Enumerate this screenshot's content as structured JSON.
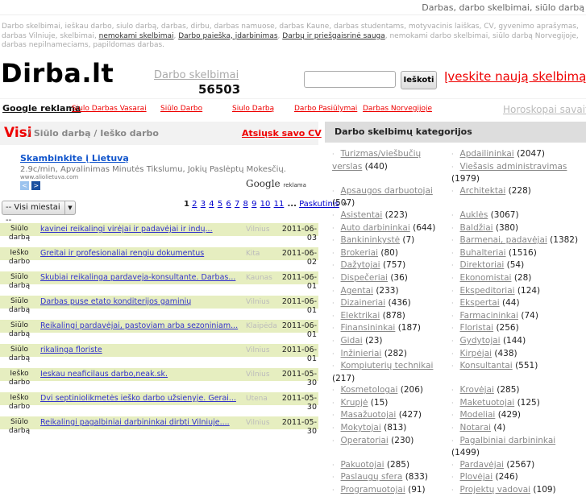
{
  "header": {
    "title": "Darbas, darbo skelbimai, siūlo darbą",
    "keywords_a": "Darbo skelbimai, ieškau darbo, siulo darbą, darbas, dirbu, darbas namuose, darbas Kaune, darbas studentams, motyvacinis laiškas, CV, gyvenimo aprašymas, darbas Vilniuje, skelbimai, ",
    "kw_link1": "nemokami skelbimai",
    "kw_link2": "Darbo paieška, įdarbinimas",
    "kw_link3": "Darbų ir priešgaisrinė sauga",
    "keywords_b": ", nemokami darbo skelbimai, siūlo darbą Norvegijoje, darbas nepilnameciams, papildomas darbas."
  },
  "logo": "Dirba.lt",
  "counter": {
    "label": "Darbo skelbimai",
    "value": "56503"
  },
  "search": {
    "value": "",
    "button": "Ieškoti"
  },
  "new_ad": "Įveskite naują skelbimą",
  "nav": {
    "google": "Google reklama",
    "links": [
      "Siulo Darbas Vasarai",
      "Siūlo Darbo",
      "Siulo Darbą",
      "Darbo Pasiūlymai",
      "Darbas Norvegijoje"
    ],
    "horoscope": "Horoskopai savaitei"
  },
  "tabs": {
    "all": "Visi",
    "sep": "/",
    "offers": "Siūlo darbą",
    "seeks": "Ieško darbo",
    "send_cv": "Atsiųsk savo CV"
  },
  "ad": {
    "title": "Skambinkite į Lietuvą",
    "desc": "2.9c/min, Apvalinimas Minutės Tikslumu, Jokių Paslėptų Mokesčių.",
    "url": "www.aliolietuva.com",
    "google": "Google",
    "reklama": "reklama"
  },
  "city_select": "-- Visi miestai --",
  "pager": {
    "current": "1",
    "pages": [
      "2",
      "3",
      "4",
      "5",
      "6",
      "7",
      "8",
      "9",
      "10",
      "11"
    ],
    "ellipsis": "...",
    "last": "Paskutinis",
    "next": "»"
  },
  "listings": [
    {
      "type": "Siūlo darbą",
      "title": "kavinei reikalingi virėjai ir padavėjai ir indų...",
      "city": "Vilnius",
      "date": "2011-06-03"
    },
    {
      "type": "Ieško darbo",
      "title": "Greitai ir profesionaliai rengiu dokumentus",
      "city": "Kita",
      "date": "2011-06-02"
    },
    {
      "type": "Siūlo darbą",
      "title": "Skubiai reikalinga pardaveja-konsultante. Darbas...",
      "city": "Kaunas",
      "date": "2011-06-01"
    },
    {
      "type": "Siūlo darbą",
      "title": "Darbas puse etato konditerijos gaminių",
      "city": "Vilnius",
      "date": "2011-06-01"
    },
    {
      "type": "Siūlo darbą",
      "title": "Reikalingi pardavėjai, pastoviam arba sezoniniam...",
      "city": "Klaipėda",
      "date": "2011-06-01"
    },
    {
      "type": "Siūlo darbą",
      "title": "rikalinga floriste",
      "city": "Vilnius",
      "date": "2011-06-01"
    },
    {
      "type": "Ieško darbo",
      "title": "Ieskau neaficilaus darbo,neak.sk.",
      "city": "Vilnius",
      "date": "2011-05-30"
    },
    {
      "type": "Ieško darbo",
      "title": "Dvi septiniolikmetės ieško darbo užsienyje. Gerai...",
      "city": "Utena",
      "date": "2011-05-30"
    },
    {
      "type": "Siūlo darbą",
      "title": "Reikalingi pagalbiniai darbininkai dirbti Vilniuje....",
      "city": "Vilnius",
      "date": "2011-05-30"
    }
  ],
  "categories": {
    "title": "Darbo skelbimų kategorijos",
    "rows": [
      [
        [
          [
            "Turizmas/viešbučių verslas",
            "(440)"
          ]
        ],
        [
          [
            "Apdailininkai",
            "(2047)"
          ],
          [
            "Viešasis administravimas",
            "(1979)"
          ]
        ]
      ],
      [
        [
          [
            "Apsaugos darbuotojai",
            "(507)"
          ]
        ],
        [
          [
            "Architektai",
            "(228)"
          ]
        ]
      ],
      [
        [
          [
            "Asistentai",
            "(223)"
          ]
        ],
        [
          [
            "Auklės",
            "(3067)"
          ]
        ]
      ],
      [
        [
          [
            "Auto darbininkai",
            "(644)"
          ]
        ],
        [
          [
            "Baldžiai",
            "(380)"
          ]
        ]
      ],
      [
        [
          [
            "Bankininkystė",
            "(7)"
          ]
        ],
        [
          [
            "Barmenai, padavėjai",
            "(1382)"
          ]
        ]
      ],
      [
        [
          [
            "Brokeriai",
            "(80)"
          ]
        ],
        [
          [
            "Buhalteriai",
            "(1516)"
          ]
        ]
      ],
      [
        [
          [
            "Dažytojai",
            "(757)"
          ]
        ],
        [
          [
            "Direktoriai",
            "(54)"
          ]
        ]
      ],
      [
        [
          [
            "Dispečeriai",
            "(36)"
          ]
        ],
        [
          [
            "Ekonomistai",
            "(28)"
          ]
        ]
      ],
      [
        [
          [
            "Agentai",
            "(233)"
          ]
        ],
        [
          [
            "Ekspeditoriai",
            "(124)"
          ]
        ]
      ],
      [
        [
          [
            "Dizaineriai",
            "(436)"
          ]
        ],
        [
          [
            "Ekspertai",
            "(44)"
          ]
        ]
      ],
      [
        [
          [
            "Elektrikai",
            "(878)"
          ]
        ],
        [
          [
            "Farmacininkai",
            "(74)"
          ]
        ]
      ],
      [
        [
          [
            "Finansininkai",
            "(187)"
          ]
        ],
        [
          [
            "Floristai",
            "(256)"
          ]
        ]
      ],
      [
        [
          [
            "Gidai",
            "(23)"
          ]
        ],
        [
          [
            "Gydytojai",
            "(144)"
          ]
        ]
      ],
      [
        [
          [
            "Inžinieriai",
            "(282)"
          ]
        ],
        [
          [
            "Kirpėjai",
            "(438)"
          ]
        ]
      ],
      [
        [
          [
            "Kompiuterių technikai",
            "(217)"
          ]
        ],
        [
          [
            "Konsultantai",
            "(551)"
          ]
        ]
      ],
      [
        [
          [
            "Kosmetologai",
            "(206)"
          ]
        ],
        [
          [
            "Krovėjai",
            "(285)"
          ]
        ]
      ],
      [
        [
          [
            "Krupjė",
            "(15)"
          ]
        ],
        [
          [
            "Maketuotojai",
            "(125)"
          ]
        ]
      ],
      [
        [
          [
            "Masažuotojai",
            "(427)"
          ]
        ],
        [
          [
            "Modeliai",
            "(429)"
          ]
        ]
      ],
      [
        [
          [
            "Mokytojai",
            "(813)"
          ]
        ],
        [
          [
            "Notarai",
            "(4)"
          ]
        ]
      ],
      [
        [
          [
            "Operatoriai",
            "(230)"
          ]
        ],
        [
          [
            "Pagalbiniai darbininkai",
            "(1499)"
          ]
        ]
      ],
      [
        [
          [
            "Pakuotojai",
            "(285)"
          ]
        ],
        [
          [
            "Pardavėjai",
            "(2567)"
          ]
        ]
      ],
      [
        [
          [
            "Paslaugų sfera",
            "(833)"
          ]
        ],
        [
          [
            "Plovėjai",
            "(246)"
          ]
        ]
      ],
      [
        [
          [
            "Programuotojai",
            "(91)"
          ]
        ],
        [
          [
            "Projektų vadovai",
            "(109)"
          ]
        ]
      ]
    ]
  },
  "colors": {
    "accent": "#ee0000",
    "row_band": "#e6eec0",
    "link": "#3333cc"
  }
}
